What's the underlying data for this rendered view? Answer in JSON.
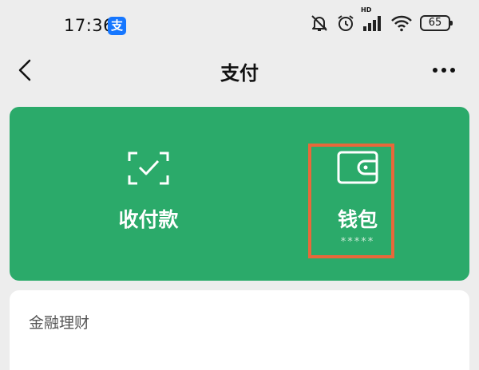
{
  "status_bar": {
    "time": "17:36",
    "alipay_badge": "支",
    "hd_label": "HD",
    "battery": "65"
  },
  "nav": {
    "title": "支付"
  },
  "pay_card": {
    "background": "#2baa6a",
    "receive_label": "收付款",
    "wallet_label": "钱包",
    "wallet_balance": "*****",
    "highlight_color": "#e8683a"
  },
  "finance": {
    "title": "金融理财"
  }
}
